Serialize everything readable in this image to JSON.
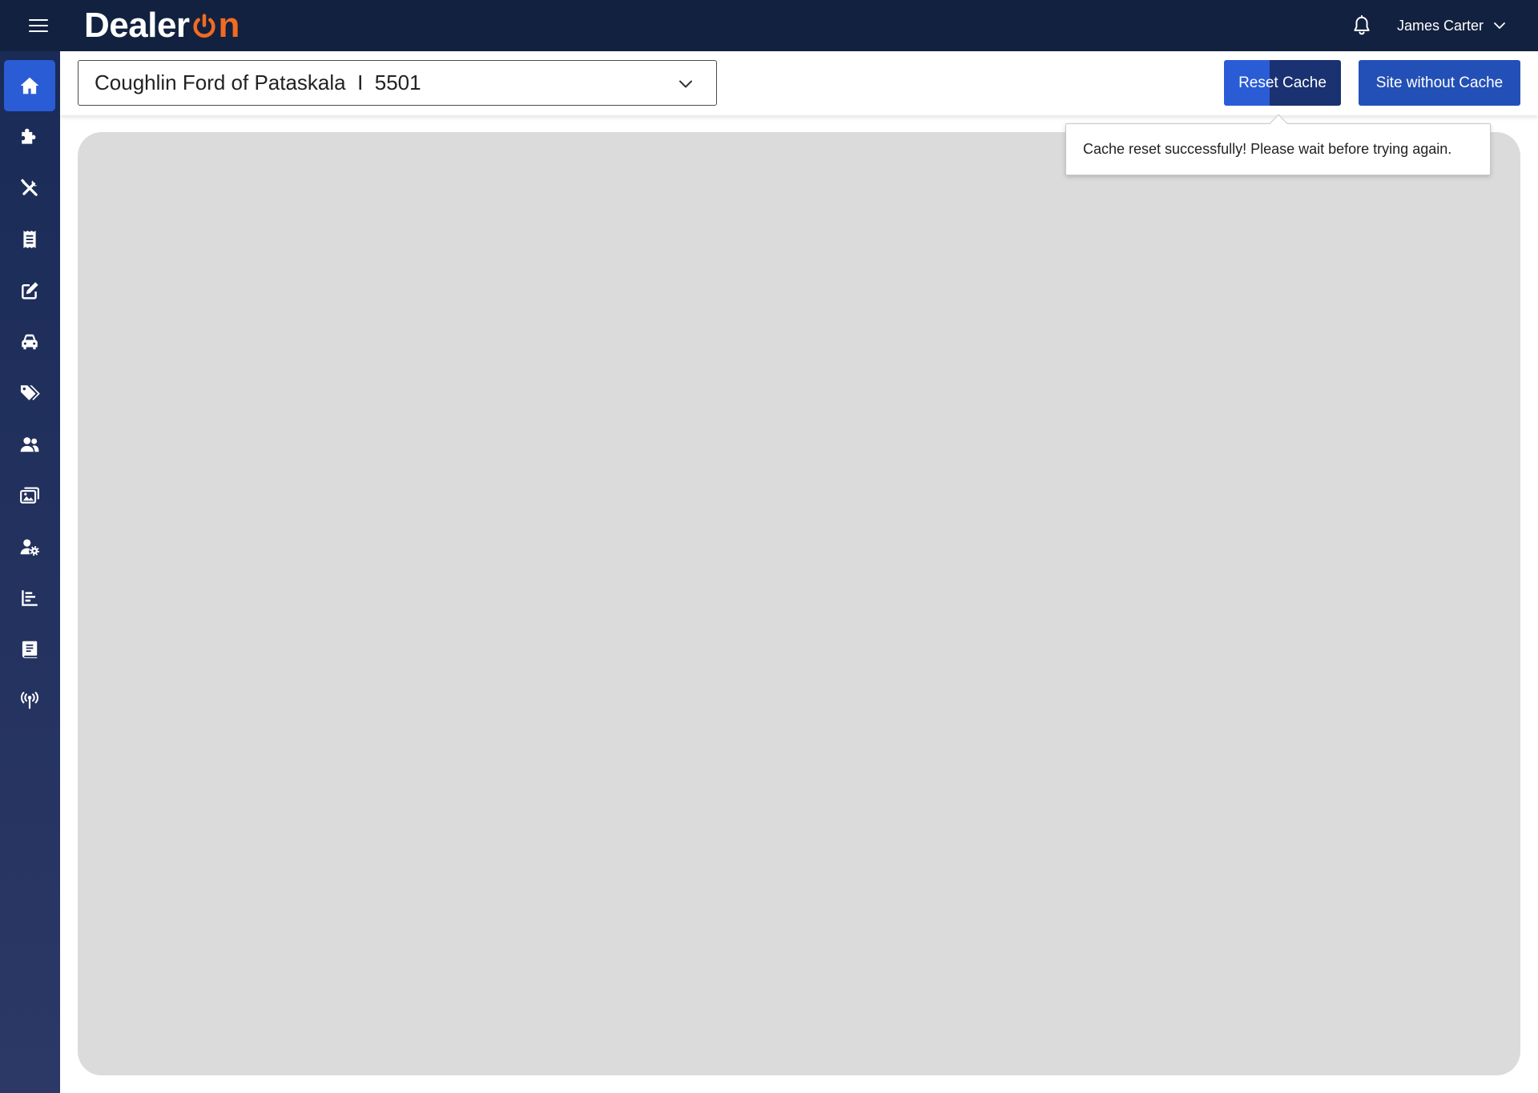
{
  "logo": {
    "text": "DealerOn"
  },
  "topbar": {
    "menu_icon": "hamburger-menu-icon",
    "notifications_icon": "bell-icon",
    "user_name": "James Carter",
    "user_menu_icon": "chevron-down-icon"
  },
  "sidebar": {
    "items": [
      {
        "icon": "home-icon",
        "active": true
      },
      {
        "icon": "puzzle-icon",
        "active": false
      },
      {
        "icon": "tools-icon",
        "active": false
      },
      {
        "icon": "receipt-icon",
        "active": false
      },
      {
        "icon": "edit-icon",
        "active": false
      },
      {
        "icon": "car-icon",
        "active": false
      },
      {
        "icon": "tags-icon",
        "active": false
      },
      {
        "icon": "users-icon",
        "active": false
      },
      {
        "icon": "images-icon",
        "active": false
      },
      {
        "icon": "user-cog-icon",
        "active": false
      },
      {
        "icon": "chart-bar-icon",
        "active": false
      },
      {
        "icon": "book-icon",
        "active": false
      },
      {
        "icon": "broadcast-tower-icon",
        "active": false
      }
    ]
  },
  "toolbar": {
    "dealer_select_value": "Coughlin Ford of Pataskala  I  5501",
    "dealer_select_icon": "chevron-down-icon",
    "reset_cache_label": "Reset Cache",
    "site_without_cache_label": "Site without Cache"
  },
  "tooltip": {
    "message": "Cache reset successfully! Please wait before trying again."
  },
  "colors": {
    "topbar": "#12213f",
    "sidebar_top": "#1a2b57",
    "sidebar_bottom": "#2c3866",
    "accent": "#2a5cd6",
    "logo_accent": "#f26b21",
    "content_panel": "#dbdbdb"
  }
}
